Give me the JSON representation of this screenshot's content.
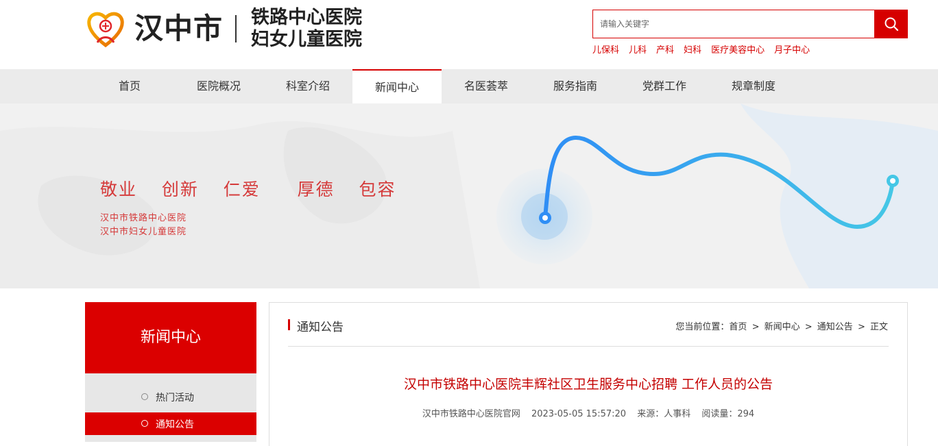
{
  "header": {
    "city": "汉中市",
    "hospital_line1": "铁路中心医院",
    "hospital_line2": "妇女儿童医院"
  },
  "search": {
    "placeholder": "请输入关键字",
    "hot_links": [
      "儿保科",
      "儿科",
      "产科",
      "妇科",
      "医疗美容中心",
      "月子中心"
    ]
  },
  "nav": {
    "items": [
      "首页",
      "医院概况",
      "科室介绍",
      "新闻中心",
      "名医荟萃",
      "服务指南",
      "党群工作",
      "规章制度"
    ],
    "active": "新闻中心"
  },
  "banner": {
    "slogan": "敬业  创新  仁爱   厚德  包容",
    "sub_line1": "汉中市铁路中心医院",
    "sub_line2": "汉中市妇女儿童医院"
  },
  "sidebar": {
    "title": "新闻中心",
    "items": [
      {
        "label": "热门活动"
      },
      {
        "label": "通知公告"
      }
    ]
  },
  "content": {
    "section_title": "通知公告",
    "breadcrumb": {
      "prefix": "您当前位置：",
      "items": [
        "首页",
        "新闻中心",
        "通知公告",
        "正文"
      ]
    },
    "article": {
      "title": "汉中市铁路中心医院丰辉社区卫生服务中心招聘 工作人员的公告",
      "publisher": "汉中市铁路中心医院官网",
      "datetime": "2023-05-05 15:57:20",
      "source": "来源：人事科",
      "views": "阅读量：294"
    }
  },
  "colors": {
    "brand_red": "#d60000",
    "nav_bg": "#ebebeb",
    "banner_line": "#3aa0f0"
  }
}
